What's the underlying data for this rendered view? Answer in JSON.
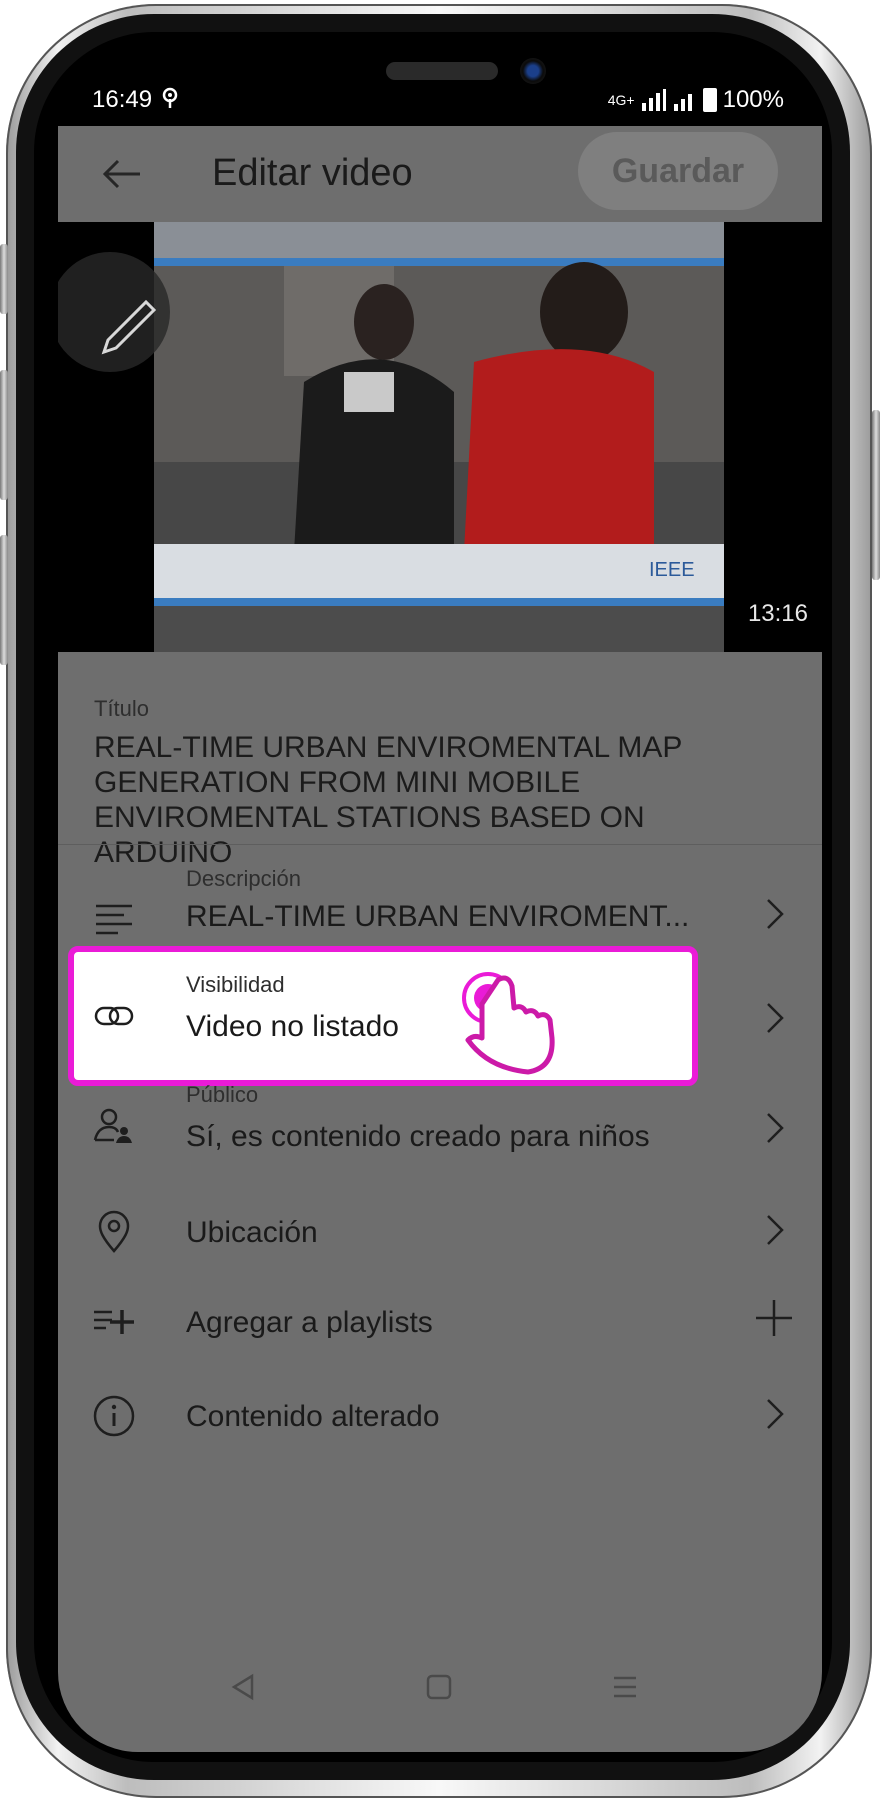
{
  "status_bar": {
    "time": "16:49",
    "network": "4G+",
    "battery": "100%"
  },
  "app_bar": {
    "title": "Editar video",
    "save_label": "Guardar"
  },
  "video": {
    "duration": "13:16",
    "watermark": "IEEE"
  },
  "title_field": {
    "label": "Título",
    "value": "REAL-TIME URBAN ENVIROMENTAL MAP GENERATION FROM MINI MOBILE ENVIROMENTAL STATIONS BASED ON ARDUINO"
  },
  "rows": {
    "description": {
      "label": "Descripción",
      "value": "REAL-TIME URBAN ENVIROMENT..."
    },
    "visibility": {
      "label": "Visibilidad",
      "value": "Video no listado"
    },
    "audience": {
      "label": "Público",
      "value": "Sí, es contenido creado para niños"
    },
    "location": {
      "value": "Ubicación"
    },
    "playlists": {
      "value": "Agregar a playlists"
    },
    "altered": {
      "value": "Contenido alterado"
    }
  },
  "colors": {
    "highlight": "#ea1bd7",
    "overlay": "#6e6e6e"
  }
}
